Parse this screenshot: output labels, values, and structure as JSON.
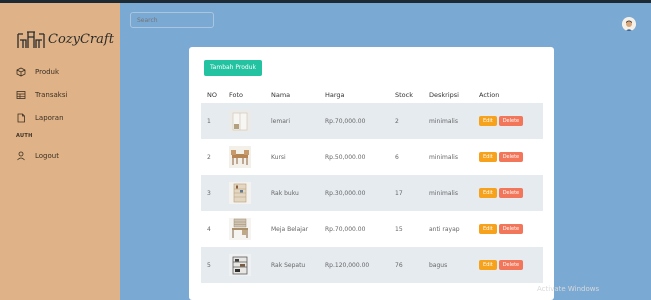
{
  "brand": {
    "name": "CozyCraft"
  },
  "sidebar": {
    "items": [
      {
        "label": "Produk",
        "icon": "box-icon"
      },
      {
        "label": "Transaksi",
        "icon": "table-icon"
      },
      {
        "label": "Laporan",
        "icon": "file-icon"
      }
    ],
    "section_title": "AUTH",
    "logout_label": "Logout"
  },
  "search": {
    "placeholder": "Search"
  },
  "content": {
    "add_button_label": "Tambah Produk",
    "columns": [
      "NO",
      "Foto",
      "Nama",
      "Harga",
      "Stock",
      "Deskripsi",
      "Action"
    ],
    "edit_label": "Edit",
    "delete_label": "Delete",
    "rows": [
      {
        "no": "1",
        "nama": "lemari",
        "harga": "Rp.70,000.00",
        "stock": "2",
        "deskripsi": "minimalis"
      },
      {
        "no": "2",
        "nama": "Kursi",
        "harga": "Rp.50,000.00",
        "stock": "6",
        "deskripsi": "minimalis"
      },
      {
        "no": "3",
        "nama": "Rak buku",
        "harga": "Rp.30,000.00",
        "stock": "17",
        "deskripsi": "minimalis"
      },
      {
        "no": "4",
        "nama": "Meja Belajar",
        "harga": "Rp.70,000.00",
        "stock": "15",
        "deskripsi": "anti rayap"
      },
      {
        "no": "5",
        "nama": "Rak Sepatu",
        "harga": "Rp.120,000.00",
        "stock": "76",
        "deskripsi": "bagus"
      }
    ]
  },
  "colors": {
    "sidebar": "#dfb387",
    "background": "#7aa9d3",
    "add_button": "#23c2a0",
    "edit": "#f7a21c",
    "delete": "#f2765a"
  },
  "watermark": "Activate Windows"
}
